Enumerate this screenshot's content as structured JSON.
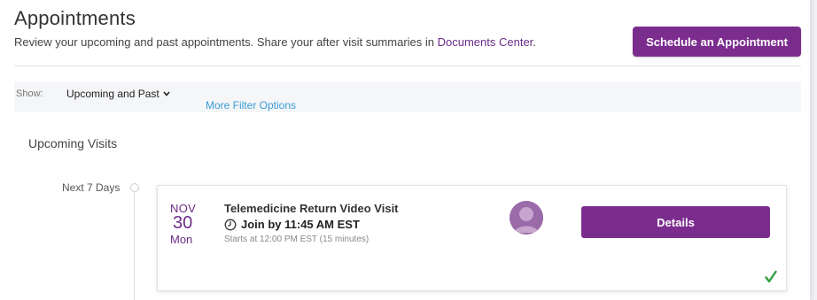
{
  "header": {
    "title": "Appointments",
    "subtitle_prefix": "Review your upcoming and past appointments. Share your after visit summaries in ",
    "subtitle_link": "Documents Center",
    "subtitle_suffix": ".",
    "schedule_button": "Schedule an Appointment"
  },
  "filter": {
    "show_label": "Show:",
    "selected": "Upcoming and Past",
    "more_link": "More Filter Options"
  },
  "section": {
    "title": "Upcoming Visits",
    "timeline_label": "Next 7 Days"
  },
  "appointment": {
    "month": "NOV",
    "day": "30",
    "weekday": "Mon",
    "title": "Telemedicine Return Video Visit",
    "join_text": "Join by 11:45 AM EST",
    "meta": "Starts at 12:00 PM EST (15 minutes)",
    "details_button": "Details",
    "status_icon": "checkmark-icon"
  },
  "colors": {
    "brand_purple": "#7b2d8e",
    "link_blue": "#3a9bd6",
    "check_green": "#2e9e3e"
  }
}
